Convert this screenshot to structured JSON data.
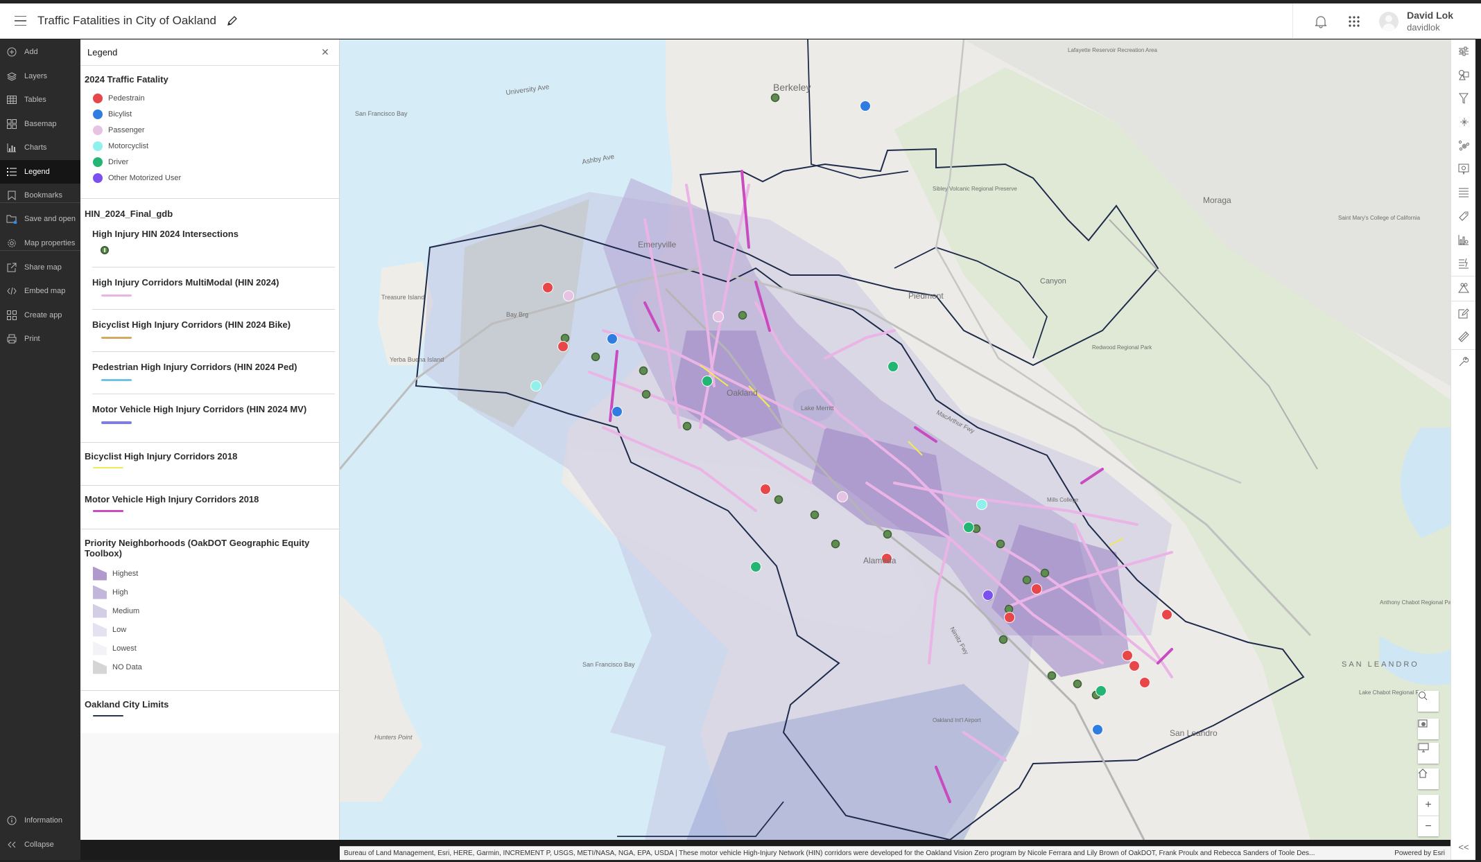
{
  "header": {
    "title": "Traffic Fatalities in City of Oakland",
    "user_name": "David Lok",
    "user_id": "davidlok",
    "icons": [
      "menu-icon",
      "edit-icon",
      "bell-icon",
      "apps-grid-icon",
      "avatar"
    ]
  },
  "leftnav": {
    "items": [
      {
        "label": "Add",
        "icon": "add-icon"
      },
      {
        "label": "Layers",
        "icon": "layers-icon"
      },
      {
        "label": "Tables",
        "icon": "table-icon"
      },
      {
        "label": "Basemap",
        "icon": "basemap-icon"
      },
      {
        "label": "Charts",
        "icon": "chart-icon"
      },
      {
        "label": "Legend",
        "icon": "legend-icon",
        "active": true
      },
      {
        "label": "Bookmarks",
        "icon": "bookmark-icon"
      },
      {
        "label": "Save and open",
        "icon": "folder-icon"
      },
      {
        "label": "Map properties",
        "icon": "gear-icon"
      },
      {
        "label": "Share map",
        "icon": "share-icon"
      },
      {
        "label": "Embed map",
        "icon": "code-icon"
      },
      {
        "label": "Create app",
        "icon": "apps-icon"
      },
      {
        "label": "Print",
        "icon": "print-icon"
      }
    ],
    "information": "Information",
    "collapse": "Collapse"
  },
  "legend": {
    "panel_title": "Legend",
    "fatality": {
      "title": "2024 Traffic Fatality",
      "items": [
        {
          "label": "Pedestrain",
          "color": "#e8474a"
        },
        {
          "label": "Bicylist",
          "color": "#2f7de0"
        },
        {
          "label": "Passenger",
          "color": "#e6c3e3"
        },
        {
          "label": "Motorcyclist",
          "color": "#8ff0ec"
        },
        {
          "label": "Driver",
          "color": "#22b573"
        },
        {
          "label": "Other Motorized User",
          "color": "#7b4ff0"
        }
      ]
    },
    "hin_group": {
      "title": "HIN_2024_Final_gdb",
      "layers": [
        {
          "title": "High Injury HIN 2024 Intersections",
          "symbol": "intersection-marker",
          "color": "#5f8c50"
        },
        {
          "title": "High Injury Corridors MultiModal (HIN 2024)",
          "color": "#ebb4e6"
        },
        {
          "title": "Bicyclist High Injury Corridors (HIN 2024 Bike)",
          "color": "#d6a760"
        },
        {
          "title": "Pedestrian High Injury Corridors (HIN 2024 Ped)",
          "color": "#6fc3e6"
        },
        {
          "title": "Motor Vehicle High Injury Corridors (HIN 2024 MV)",
          "color": "#8080dc"
        }
      ]
    },
    "bike_2018": {
      "title": "Bicyclist High Injury Corridors 2018",
      "color": "#f2ea54"
    },
    "mv_2018": {
      "title": "Motor Vehicle High Injury Corridors 2018",
      "color": "#c84bc0"
    },
    "priority": {
      "title": "Priority Neighborhoods (OakDOT Geographic Equity Toolbox)",
      "items": [
        {
          "label": "Highest",
          "color": "#b199cd"
        },
        {
          "label": "High",
          "color": "#c2b6db"
        },
        {
          "label": "Medium",
          "color": "#d3cde6"
        },
        {
          "label": "Low",
          "color": "#e4e1f0"
        },
        {
          "label": "Lowest",
          "color": "#f3f2f6"
        },
        {
          "label": "NO Data",
          "color": "#d5d5d5"
        }
      ]
    },
    "city_limits": {
      "title": "Oakland City Limits",
      "color": "#2a3550"
    }
  },
  "map": {
    "labels": {
      "berkeley": "Berkeley",
      "emeryville": "Emeryville",
      "oakland": "Oakland",
      "piedmont": "Piedmont",
      "alameda": "Alameda",
      "moraga": "Moraga",
      "canyon": "Canyon",
      "san_leandro": "San Leandro",
      "san_leandro_hills": "SAN LEANDRO",
      "sf_bay_north": "San Francisco Bay",
      "sf_bay_south": "San Francisco Bay",
      "treasure_island": "Treasure Island",
      "yerba_buena": "Yerba Buena Island",
      "lake_merritt": "Lake Merritt",
      "bay_brg": "Bay Brg",
      "university_ave": "University Ave",
      "ashby_ave": "Ashby Ave",
      "macarthur_fwy": "MacArthur Fwy",
      "nimitz_fwy": "Nimitz Fwy",
      "hunters_point": "Hunters Point",
      "oakland_airport": "Oakland Int'l Airport",
      "lafayette": "Lafayette Reservoir Recreation Area",
      "redwood_park": "Redwood Regional Park",
      "lake_chabot": "Lake Chabot Regional Park",
      "mills_college": "Mills College",
      "sibley": "Sibley Volcanic Regional Preserve",
      "saint_marys": "Saint Mary's College of California",
      "anthony_chabot": "Anthony Chabot Regional Park"
    },
    "widgets": [
      "search-button",
      "basemap-gallery-button",
      "fullscreen-button",
      "home-button",
      "zoom-in-button",
      "zoom-out-button"
    ]
  },
  "attribution": {
    "text": "Bureau of Land Management, Esri, HERE, Garmin, INCREMENT P, USGS, METI/NASA, NGA, EPA, USDA | These motor vehicle High-Injury Network (HIN) corridors were developed for the Oakland Vision Zero program by Nicole Ferrara and Lily Brown of OakDOT, Frank Proulx and Rebecca Sanders of Toole Des...",
    "powered_by": "Powered by Esri"
  },
  "rightrail": {
    "tools": [
      "properties-icon",
      "styles-icon",
      "filter-icon",
      "effects-icon",
      "clustering-icon",
      "popups-icon",
      "fields-icon",
      "labels-icon",
      "charts-config-icon",
      "configure-popup-icon",
      "sketch-icon",
      "edit-icon",
      "measure-icon",
      "tools-icon"
    ],
    "collapse": "<<"
  }
}
